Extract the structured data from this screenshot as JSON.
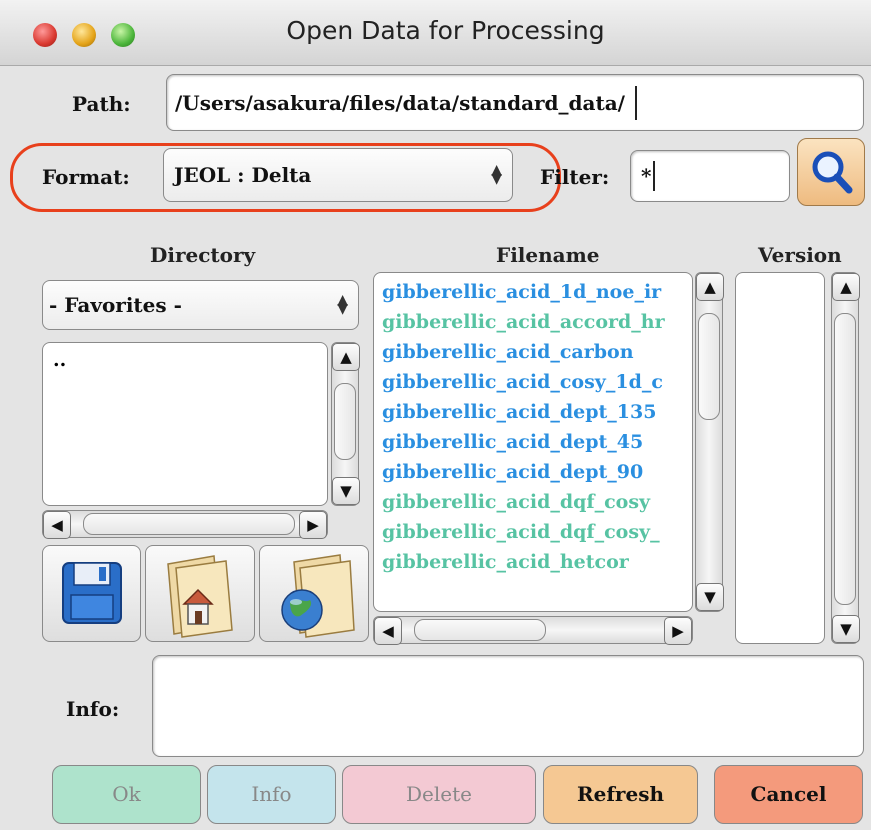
{
  "window": {
    "title": "Open Data for Processing"
  },
  "path": {
    "label": "Path:",
    "value": "/Users/asakura/files/data/standard_data/"
  },
  "format": {
    "label": "Format:",
    "selected": "JEOL : Delta"
  },
  "filter": {
    "label": "Filter:",
    "value": "*"
  },
  "search_icon": "magnifier-icon",
  "columns": {
    "directory": "Directory",
    "filename": "Filename",
    "version": "Version"
  },
  "directory": {
    "selected": "- Favorites -",
    "items": [
      ".."
    ]
  },
  "files": [
    {
      "name": "gibberellic_acid_1d_noe_ir",
      "color": "#2a8fe0"
    },
    {
      "name": "gibberellic_acid_accord_hr",
      "color": "#57c3a3"
    },
    {
      "name": "gibberellic_acid_carbon",
      "color": "#2a8fe0"
    },
    {
      "name": "gibberellic_acid_cosy_1d_c",
      "color": "#2a8fe0"
    },
    {
      "name": "gibberellic_acid_dept_135",
      "color": "#2a8fe0"
    },
    {
      "name": "gibberellic_acid_dept_45",
      "color": "#2a8fe0"
    },
    {
      "name": "gibberellic_acid_dept_90",
      "color": "#2a8fe0"
    },
    {
      "name": "gibberellic_acid_dqf_cosy",
      "color": "#57c3a3"
    },
    {
      "name": "gibberellic_acid_dqf_cosy_",
      "color": "#57c3a3"
    },
    {
      "name": "gibberellic_acid_hetcor",
      "color": "#57c3a3"
    }
  ],
  "info": {
    "label": "Info:",
    "value": ""
  },
  "buttons": {
    "ok": {
      "label": "Ok",
      "color": "#aee3cc"
    },
    "info": {
      "label": "Info",
      "color": "#c4e4ec"
    },
    "delete": {
      "label": "Delete",
      "color": "#f3c9d3"
    },
    "refresh": {
      "label": "Refresh",
      "color": "#f5c893"
    },
    "cancel": {
      "label": "Cancel",
      "color": "#f49a7c"
    }
  },
  "shortcut_icons": [
    "floppy-disk-icon",
    "home-folder-icon",
    "globe-folder-icon"
  ]
}
